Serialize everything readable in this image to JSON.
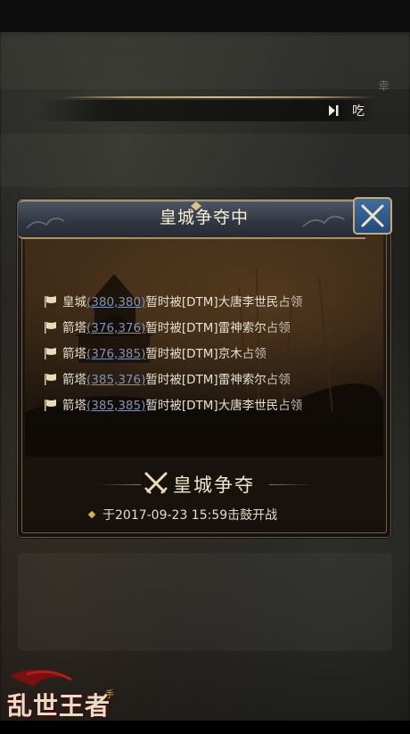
{
  "chat": {
    "message": "吃",
    "corner_text": "幸"
  },
  "panel": {
    "title": "皇城争夺中",
    "entries": [
      {
        "place": "皇城",
        "coord": "(380,380)",
        "prefix": "暂时被[DTM]",
        "owner": "大唐李世民",
        "suffix": "占领"
      },
      {
        "place": "箭塔",
        "coord": "(376,376)",
        "prefix": "暂时被[DTM]",
        "owner": "雷神索尔",
        "suffix": "占领"
      },
      {
        "place": "箭塔",
        "coord": "(376,385)",
        "prefix": "暂时被[DTM]",
        "owner": "京木",
        "suffix": "占领"
      },
      {
        "place": "箭塔",
        "coord": "(385,376)",
        "prefix": "暂时被[DTM]",
        "owner": "雷神索尔",
        "suffix": "占领"
      },
      {
        "place": "箭塔",
        "coord": "(385,385)",
        "prefix": "暂时被[DTM]",
        "owner": "大唐李世民",
        "suffix": "占领"
      }
    ],
    "section_title": "皇城争夺",
    "start_prefix": "于2017-09-23   15:59",
    "start_suffix": "击鼓开战"
  },
  "logo": {
    "text": "乱世王者",
    "badge": "手"
  },
  "icons": {
    "close": "close-x-icon",
    "flag": "flag-icon",
    "crossed_swords": "crossed-swords-icon",
    "voice": "voice-mute-icon"
  },
  "colors": {
    "coord_link": "#7f93b3",
    "gold": "#c7ab72",
    "close_button": "#3f6ea1"
  }
}
